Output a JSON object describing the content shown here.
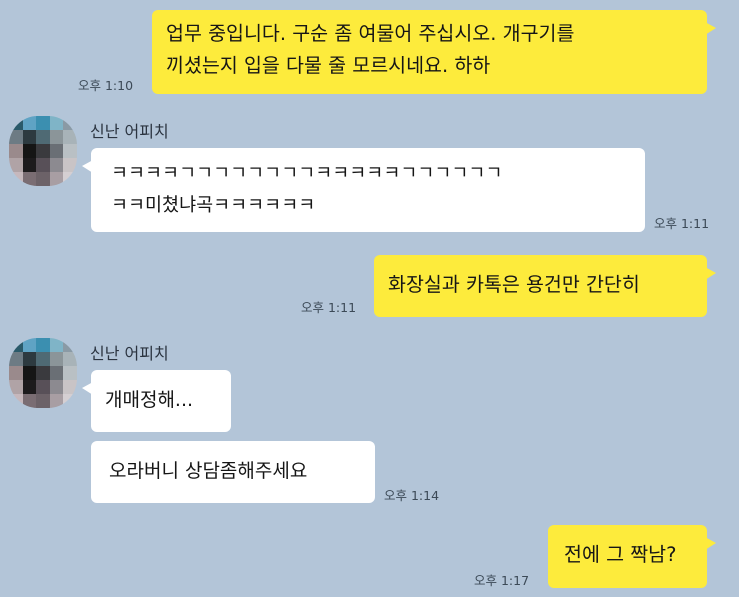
{
  "messages": [
    {
      "id": "m1",
      "sender": "me",
      "lines": [
        "업무 중입니다. 구순 좀 여물어 주십시오. 개구기를",
        "끼셨는지 입을 다물 줄 모르시네요. 하하"
      ],
      "time": "오후 1:10"
    },
    {
      "id": "m2",
      "sender": "other",
      "name": "신난 어피치",
      "lines": [
        "ㅋㅋㅋㅋㄱㄱㄱㄱㄱㄱㄱㄱㅋㅋㅋㅋㅋㄱㄱㄱㄱㄱㄱ",
        "ㅋㅋ미쳤냐곡ㅋㅋㅋㅋㅋㅋ"
      ],
      "time": "오후 1:11"
    },
    {
      "id": "m3",
      "sender": "me",
      "lines": [
        "화장실과 카톡은 용건만 간단히"
      ],
      "time": "오후 1:11"
    },
    {
      "id": "m4",
      "sender": "other",
      "name": "신난 어피치",
      "lines": [
        "개매정해..."
      ]
    },
    {
      "id": "m5",
      "sender": "other",
      "lines": [
        "오라버니 상담좀해주세요"
      ],
      "time": "오후 1:14"
    },
    {
      "id": "m6",
      "sender": "me",
      "lines": [
        "전에 그 짝남?"
      ],
      "time": "오후 1:17"
    }
  ],
  "colors": {
    "background": "#b3c5d8",
    "my_bubble": "#fdeb3c",
    "their_bubble": "#ffffff"
  },
  "avatar": {
    "icon": "pixelated-profile-photo"
  }
}
